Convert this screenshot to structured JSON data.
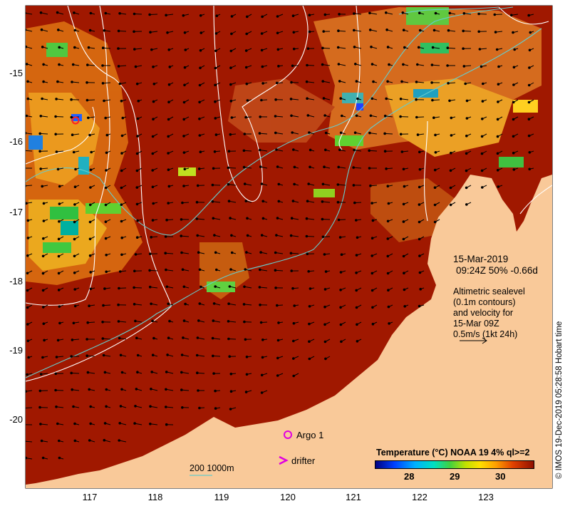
{
  "map": {
    "lon_range": [
      116.0,
      124.0
    ],
    "lat_range": [
      -21.0,
      -14.0
    ],
    "lon_ticks": [
      "117",
      "118",
      "119",
      "120",
      "121",
      "122",
      "123"
    ],
    "lat_ticks": [
      "-15",
      "-16",
      "-17",
      "-18",
      "-19",
      "-20"
    ],
    "colors": {
      "land": "#f9c999",
      "sea_warm": "#a01800",
      "contour_white": "#ffffff",
      "contour_cyan": "#66cccc",
      "vector": "#000000",
      "argo": "#e000e0"
    }
  },
  "annotation": {
    "date": "15-Mar-2019",
    "pass": "09:24Z  50% -0.66d",
    "altimetry_lines": [
      "Altimetric sealevel",
      "(0.1m contours)",
      "and velocity for",
      "15-Mar 09Z",
      "0.5m/s (1kt 24h)"
    ]
  },
  "legend": {
    "argo_label": "Argo 1",
    "drifter_label": "drifter",
    "scale_label": "200  1000m",
    "title": "Temperature (°C) NOAA 19 4% ql>=2",
    "colorbar_ticks": [
      "28",
      "29",
      "30"
    ],
    "colorbar_range": [
      27.0,
      31.0
    ]
  },
  "credit": "© IMOS 19-Dec-2019 05:28:58 Hobart time",
  "markers": {
    "argo_float": {
      "lon": 120.0,
      "lat": -20.22
    },
    "red_circle": {
      "lon": 116.78,
      "lat": -15.7
    }
  }
}
